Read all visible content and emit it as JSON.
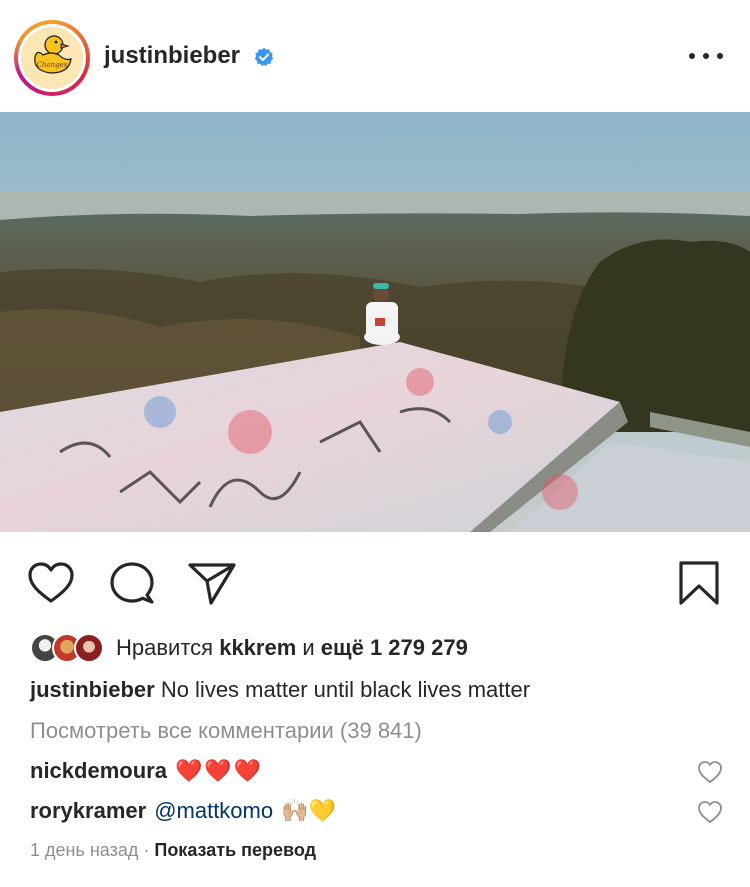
{
  "post": {
    "username": "justinbieber",
    "verified_icon": "verified-badge-icon",
    "more_icon": "more-options-icon",
    "avatar_text": "Changes"
  },
  "actions": {
    "like_icon": "heart-icon",
    "comment_icon": "comment-icon",
    "share_icon": "paper-plane-icon",
    "save_icon": "bookmark-icon"
  },
  "likes": {
    "prefix": "Нравится ",
    "user": "kkkrem",
    "middle": " и ",
    "count": "ещё 1 279 279"
  },
  "caption": {
    "user": "justinbieber",
    "text": "No lives matter until black lives matter"
  },
  "view_all_comments": "Посмотреть все комментарии (39 841)",
  "comments": [
    {
      "user": "nickdemoura",
      "text": "❤️❤️❤️"
    },
    {
      "user": "rorykramer",
      "mention": "@mattkomo",
      "text": "🙌🏼💛"
    }
  ],
  "footer": {
    "time": "1 день назад",
    "separator": " · ",
    "translate": "Показать перевод"
  },
  "colors": {
    "text": "#262626",
    "secondary": "#8e8e8e",
    "mention": "#003569",
    "verified": "#3897f0",
    "heart": "#ed4956"
  }
}
